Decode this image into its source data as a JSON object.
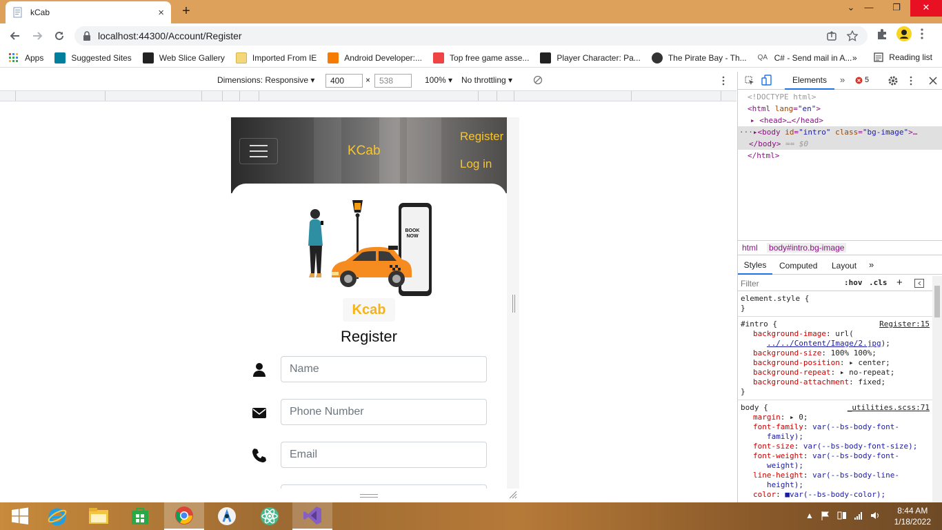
{
  "browser": {
    "tab_title": "kCab",
    "tab_close": "×",
    "new_tab": "+",
    "url": "localhost:44300/Account/Register",
    "window": {
      "minimize": "—",
      "restore": "❐",
      "close": "✕",
      "tabs_menu": "⌄"
    },
    "bookmarks": [
      {
        "label": "Apps",
        "icon": "apps-grid-icon",
        "color": "#4285f4"
      },
      {
        "label": "Suggested Sites",
        "icon": "bing-icon",
        "color": "#00809d"
      },
      {
        "label": "Web Slice Gallery",
        "icon": "web-slice-icon",
        "color": "#222222"
      },
      {
        "label": "Imported From IE",
        "icon": "folder-icon",
        "color": "#f4c542"
      },
      {
        "label": "Android Developer:...",
        "icon": "blogger-icon",
        "color": "#f57c00"
      },
      {
        "label": "Top free game asse...",
        "icon": "itch-icon",
        "color": "#e44"
      },
      {
        "label": "Player Character: Pa...",
        "icon": "unity-icon",
        "color": "#222222"
      },
      {
        "label": "The Pirate Bay - Th...",
        "icon": "pirate-icon",
        "color": "#333333"
      },
      {
        "label": "C# - Send mail in A...",
        "icon": "qa-icon",
        "color": "#555555"
      }
    ],
    "bookmarks_overflow": "»",
    "reading_list": "Reading list"
  },
  "device_toolbar": {
    "dimensions_label": "Dimensions: Responsive",
    "width": "400",
    "height": "538",
    "times": "×",
    "zoom": "100%",
    "throttling": "No throttling"
  },
  "app": {
    "brand": "KCab",
    "nav_register": "Register",
    "nav_login": "Log in",
    "logo_text": "Kcab",
    "phone_text_1": "BOOK",
    "phone_text_2": "NOW",
    "heading": "Register",
    "fields": [
      {
        "placeholder": "Name",
        "icon": "user-icon"
      },
      {
        "placeholder": "Phone Number",
        "icon": "envelope-icon"
      },
      {
        "placeholder": "Email",
        "icon": "phone-icon"
      }
    ],
    "brand_color": "#f7c62f"
  },
  "devtools": {
    "tab_elements": "Elements",
    "more_tabs": "»",
    "error_count": "5",
    "dom": {
      "doctype": "<!DOCTYPE html>",
      "html_open": "<html",
      "lang_attr": "lang",
      "lang_val": "\"en\"",
      "head": "<head>…</head>",
      "body_open": "<body",
      "id_attr": "id",
      "id_val": "\"intro\"",
      "class_attr": "class",
      "class_val": "\"bg-image\"",
      "body_ellipsis": ">…",
      "body_close": "</body>",
      "selected_marker": "== $0",
      "html_close": "</html>"
    },
    "breadcrumbs": [
      "html",
      "body#intro.bg-image"
    ],
    "style_tabs": [
      "Styles",
      "Computed",
      "Layout",
      "»"
    ],
    "filter_placeholder": "Filter",
    "hov": ":hov",
    "cls": ".cls",
    "rules": {
      "element_style": "element.style {",
      "close_brace": "}",
      "intro_selector": "#intro {",
      "intro_source": "Register:15",
      "intro_props": [
        {
          "name": "background-image",
          "value": "url("
        },
        {
          "name": "",
          "value": "../../Content/Image/2.jpg"
        },
        {
          "name": "background-size",
          "value": "100% 100%;"
        },
        {
          "name": "background-position",
          "value": "▸ center;"
        },
        {
          "name": "background-repeat",
          "value": "▸ no-repeat;"
        },
        {
          "name": "background-attachment",
          "value": "fixed;"
        }
      ],
      "url_close": ");",
      "body_selector": "body {",
      "body_source": "_utilities.scss:71",
      "body_props": [
        {
          "name": "margin",
          "value": "▸ 0;"
        },
        {
          "name": "font-family",
          "value": "var(--bs-body-font-"
        },
        {
          "name": "",
          "value": "family);"
        },
        {
          "name": "font-size",
          "value": "var(--bs-body-font-size);"
        },
        {
          "name": "font-weight",
          "value": "var(--bs-body-font-"
        },
        {
          "name": "",
          "value": "weight);"
        },
        {
          "name": "line-height",
          "value": "var(--bs-body-line-"
        },
        {
          "name": "",
          "value": "height);"
        },
        {
          "name": "color",
          "value": "■var(--bs-body-color);"
        }
      ]
    }
  },
  "taskbar": {
    "time": "8:44 AM",
    "date": "1/18/2022"
  }
}
